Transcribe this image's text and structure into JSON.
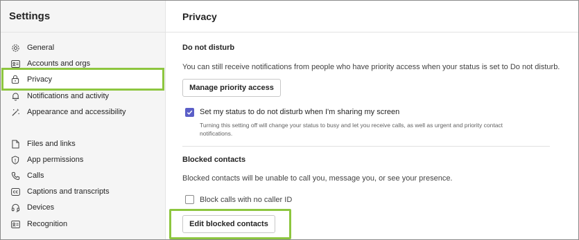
{
  "sidebar": {
    "title": "Settings",
    "items": [
      {
        "label": "General",
        "icon": "gear-icon"
      },
      {
        "label": "Accounts and orgs",
        "icon": "id-card-icon"
      },
      {
        "label": "Privacy",
        "icon": "lock-icon",
        "selected": true
      },
      {
        "label": "Notifications and activity",
        "icon": "bell-icon"
      },
      {
        "label": "Appearance and accessibility",
        "icon": "wand-icon"
      },
      {
        "label": "Files and links",
        "icon": "file-icon"
      },
      {
        "label": "App permissions",
        "icon": "shield-icon"
      },
      {
        "label": "Calls",
        "icon": "phone-icon"
      },
      {
        "label": "Captions and transcripts",
        "icon": "captions-icon"
      },
      {
        "label": "Devices",
        "icon": "headset-icon"
      },
      {
        "label": "Recognition",
        "icon": "recognition-icon"
      }
    ]
  },
  "main": {
    "title": "Privacy",
    "dnd": {
      "title": "Do not disturb",
      "description": "You can still receive notifications from people who have priority access when your status is set to Do not disturb.",
      "button": "Manage priority access",
      "checkbox_label": "Set my status to do not disturb when I'm sharing my screen",
      "checkbox_checked": true,
      "hint_line1": "Turning this setting off will change your status to busy and let you receive calls, as well as urgent and priority contact",
      "hint_line2": "notifications."
    },
    "blocked": {
      "title": "Blocked contacts",
      "description": "Blocked contacts will be unable to call you, message you, or see your presence.",
      "checkbox_label": "Block calls with no caller ID",
      "checkbox_checked": false,
      "button": "Edit blocked contacts"
    }
  },
  "colors": {
    "highlight": "#8dc63f",
    "accent": "#5b5fc7",
    "sidebar_bg": "#f5f5f5"
  }
}
